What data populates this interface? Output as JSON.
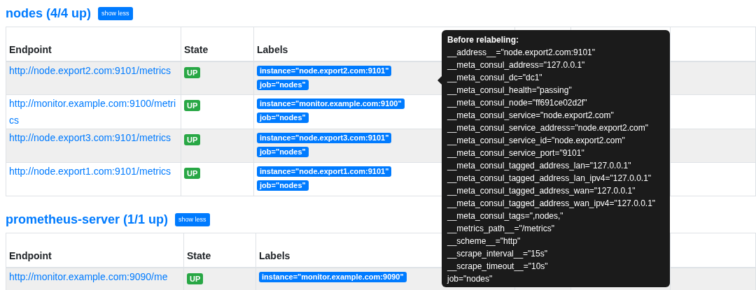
{
  "sections": [
    {
      "title": "nodes (4/4 up)",
      "button": "show less",
      "columns": [
        "Endpoint",
        "State",
        "Labels"
      ],
      "rows": [
        {
          "endpoint": "http://node.export2.com:9101/metrics",
          "state": "UP",
          "labels": [
            "instance=\"node.export2.com:9101\"",
            "job=\"nodes\""
          ]
        },
        {
          "endpoint": "http://monitor.example.com:9100/metrics",
          "state": "UP",
          "labels": [
            "instance=\"monitor.example.com:9100\"",
            "job=\"nodes\""
          ]
        },
        {
          "endpoint": "http://node.export3.com:9101/metrics",
          "state": "UP",
          "labels": [
            "instance=\"node.export3.com:9101\"",
            "job=\"nodes\""
          ]
        },
        {
          "endpoint": "http://node.export1.com:9101/metrics",
          "state": "UP",
          "labels": [
            "instance=\"node.export1.com:9101\"",
            "job=\"nodes\""
          ]
        }
      ]
    },
    {
      "title": "prometheus-server (1/1 up)",
      "button": "show less",
      "columns": [
        "Endpoint",
        "State",
        "Labels"
      ],
      "rows": [
        {
          "endpoint": "http://monitor.example.com:9090/me",
          "state": "UP",
          "labels": [
            "instance=\"monitor.example.com:9090\""
          ]
        }
      ]
    }
  ],
  "tooltip": {
    "title": "Before relabeling:",
    "lines": [
      "__address__=\"node.export2.com:9101\"",
      "__meta_consul_address=\"127.0.0.1\"",
      "__meta_consul_dc=\"dc1\"",
      "__meta_consul_health=\"passing\"",
      "__meta_consul_node=\"ff691ce02d2f\"",
      "__meta_consul_service=\"node.export2.com\"",
      "__meta_consul_service_address=\"node.export2.com\"",
      "__meta_consul_service_id=\"node.export2.com\"",
      "__meta_consul_service_port=\"9101\"",
      "__meta_consul_tagged_address_lan=\"127.0.0.1\"",
      "__meta_consul_tagged_address_lan_ipv4=\"127.0.0.1\"",
      "__meta_consul_tagged_address_wan=\"127.0.0.1\"",
      "__meta_consul_tagged_address_wan_ipv4=\"127.0.0.1\"",
      "__meta_consul_tags=\",nodes,\"",
      "__metrics_path__=\"/metrics\"",
      "__scheme__=\"http\"",
      "__scrape_interval__=\"15s\"",
      "__scrape_timeout__=\"10s\"",
      "job=\"nodes\""
    ]
  }
}
